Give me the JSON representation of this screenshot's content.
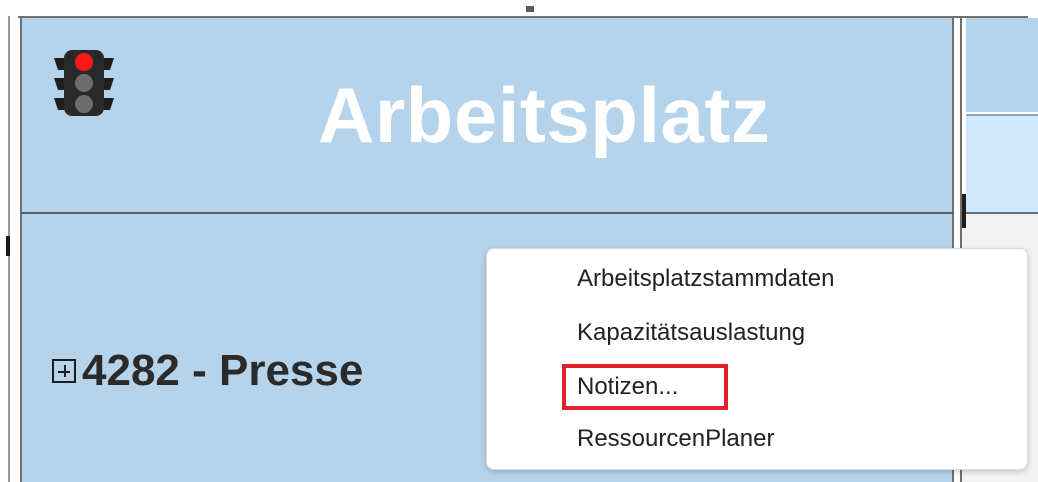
{
  "header": {
    "title": "Arbeitsplatz"
  },
  "row": {
    "label": "4282 - Presse"
  },
  "status": {
    "traffic_light": "red"
  },
  "icons": {
    "traffic_light": "traffic-light-icon",
    "expand": "expand-plus-icon"
  },
  "context_menu": {
    "items": [
      {
        "label": "Arbeitsplatzstammdaten"
      },
      {
        "label": "Kapazitätsauslastung"
      },
      {
        "label": "Notizen..."
      },
      {
        "label": "RessourcenPlaner"
      }
    ],
    "highlighted_index": 2
  },
  "colors": {
    "header_bg": "#b5d3ea",
    "alt_row_bg": "#cfe8fb",
    "highlight": "#e0202a",
    "traffic_red": "#ff1a1a"
  }
}
